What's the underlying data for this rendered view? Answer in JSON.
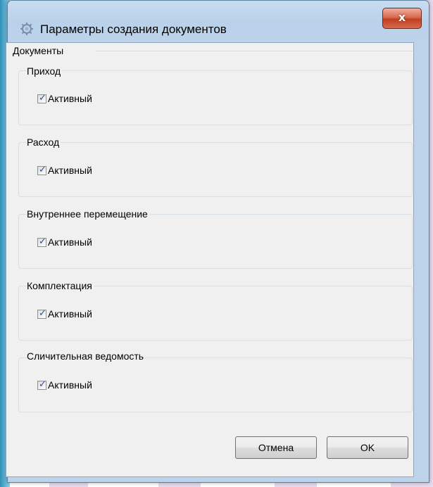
{
  "window": {
    "title": "Параметры создания документов",
    "close_glyph": "x",
    "icon": "app-gear-icon"
  },
  "documents": {
    "group_label": "Документы",
    "sections": [
      {
        "label": "Приход",
        "checkbox_label": "Активный",
        "checked": true
      },
      {
        "label": "Расход",
        "checkbox_label": "Активный",
        "checked": true
      },
      {
        "label": "Внутреннее перемещение",
        "checkbox_label": "Активный",
        "checked": true
      },
      {
        "label": "Комплектация",
        "checkbox_label": "Активный",
        "checked": true
      },
      {
        "label": "Сличительная ведомость",
        "checkbox_label": "Активный",
        "checked": true
      }
    ]
  },
  "buttons": {
    "cancel_label": "Отмена",
    "ok_label": "OK"
  },
  "check_glyph": "✓"
}
